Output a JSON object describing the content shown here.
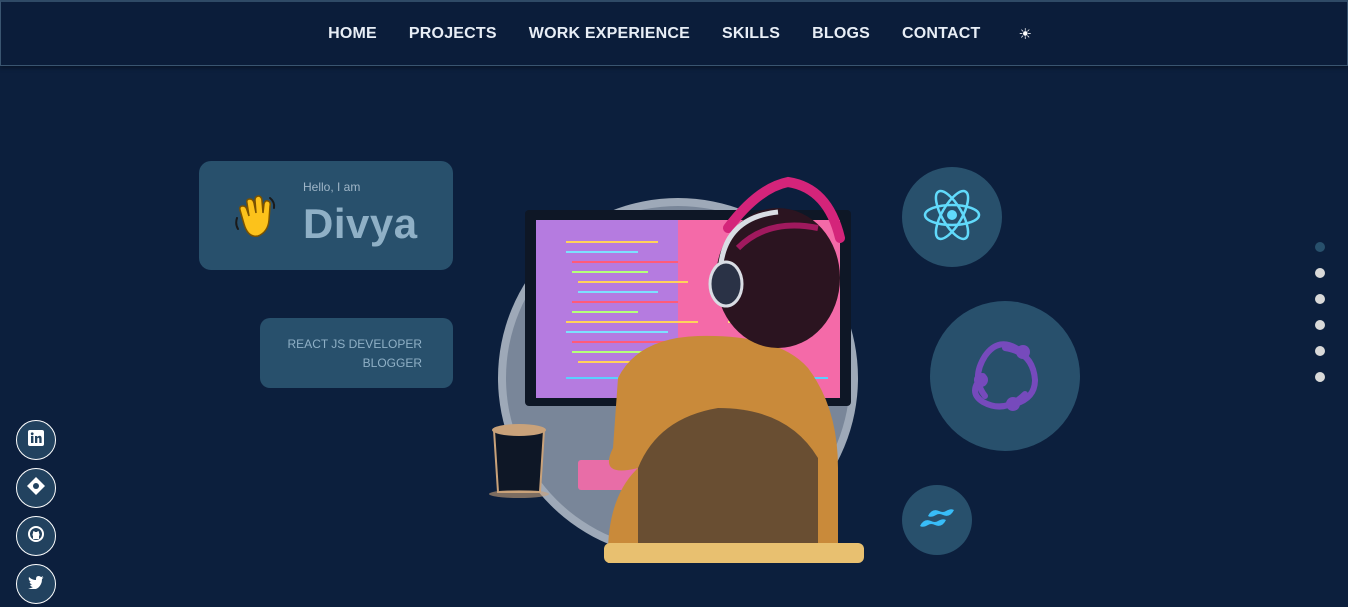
{
  "nav": {
    "links": [
      "HOME",
      "PROJECTS",
      "WORK EXPERIENCE",
      "SKILLS",
      "BLOGS",
      "CONTACT"
    ],
    "theme_toggle": "☀"
  },
  "intro": {
    "greeting": "Hello, I am",
    "name": "Divya",
    "wave_icon": "waving-hand-icon"
  },
  "roles": [
    "REACT JS DEVELOPER",
    "BLOGGER"
  ],
  "tech_icons": [
    "react-icon",
    "redux-icon",
    "tailwind-icon"
  ],
  "section_dots": {
    "count": 6,
    "active_index": 0
  },
  "socials": [
    "linkedin-icon",
    "hashnode-icon",
    "github-icon",
    "twitter-icon"
  ],
  "colors": {
    "background": "#0c1f3d",
    "card": "#28506c",
    "react": "#61dafb",
    "redux": "#764abc",
    "tailwind": "#38bdf8"
  }
}
